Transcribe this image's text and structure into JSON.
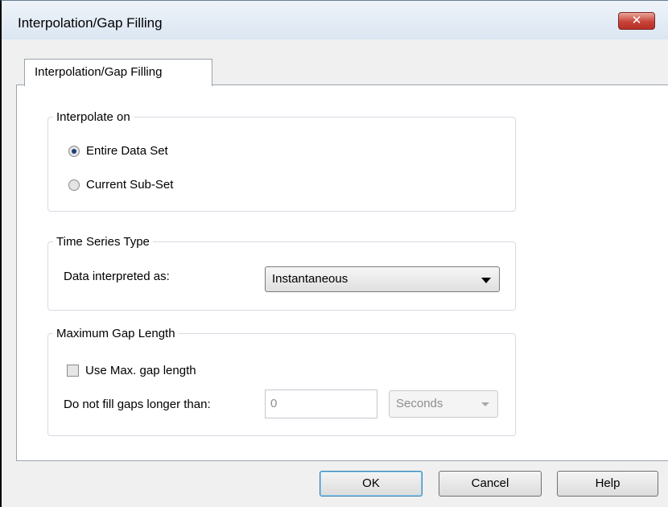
{
  "window": {
    "title": "Interpolation/Gap Filling",
    "close_glyph": "✕"
  },
  "tabs": [
    {
      "label": "Interpolation/Gap Filling",
      "selected": true
    }
  ],
  "interpolate_on": {
    "legend": "Interpolate on",
    "options": [
      {
        "label": "Entire Data Set",
        "selected": true
      },
      {
        "label": "Current Sub-Set",
        "selected": false
      }
    ]
  },
  "time_series_type": {
    "legend": "Time Series Type",
    "field_label": "Data interpreted as:",
    "selected_value": "Instantaneous"
  },
  "max_gap_length": {
    "legend": "Maximum Gap Length",
    "checkbox_label": "Use Max. gap length",
    "checked": false,
    "field_label": "Do not fill gaps longer than:",
    "value": "0",
    "unit_value": "Seconds"
  },
  "buttons": {
    "ok": "OK",
    "cancel": "Cancel",
    "help": "Help"
  },
  "icons": {
    "close": "close-icon",
    "dropdown": "chevron-down-icon"
  }
}
